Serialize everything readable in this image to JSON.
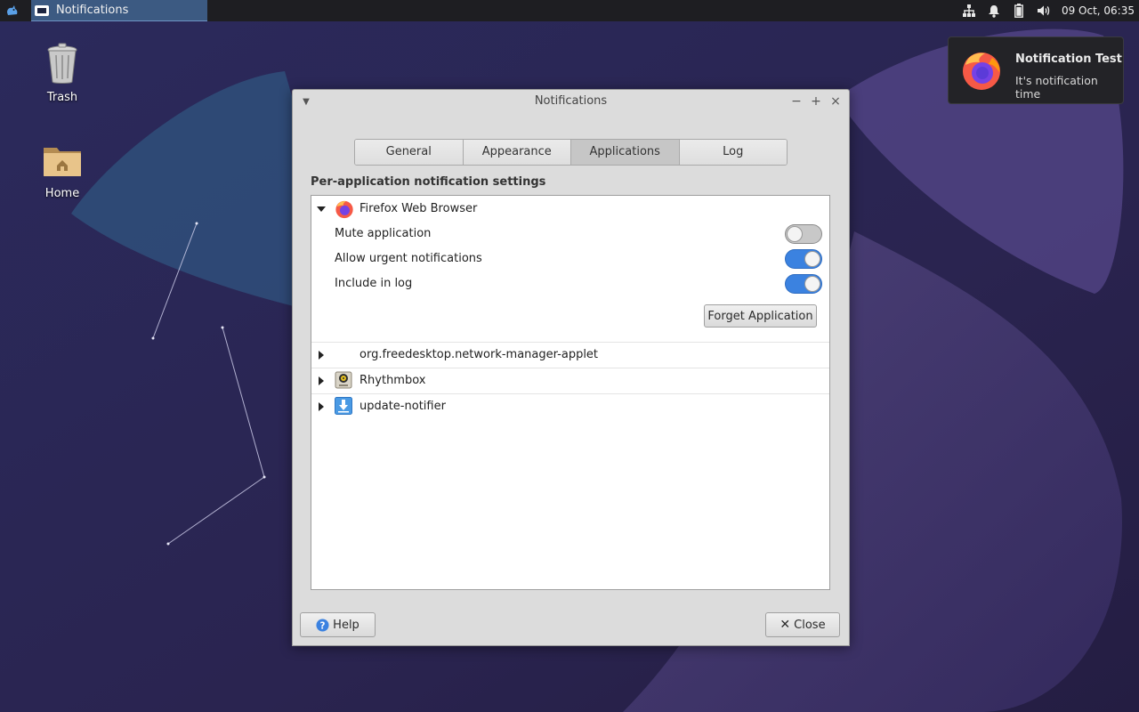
{
  "panel": {
    "task_label": "Notifications",
    "clock": "09 Oct, 06:35",
    "tray_icons": [
      "network-icon",
      "bell-icon",
      "battery-icon",
      "volume-icon"
    ]
  },
  "desktop": {
    "icons": [
      {
        "label": "Trash",
        "icon": "trash-icon"
      },
      {
        "label": "Home",
        "icon": "home-folder-icon"
      }
    ]
  },
  "notification": {
    "title": "Notification Test",
    "body": "It's notification time",
    "icon": "firefox-icon"
  },
  "window": {
    "title": "Notifications",
    "tabs": [
      {
        "label": "General",
        "active": false
      },
      {
        "label": "Appearance",
        "active": false
      },
      {
        "label": "Applications",
        "active": true
      },
      {
        "label": "Log",
        "active": false
      }
    ],
    "section_label": "Per-application notification settings",
    "apps": [
      {
        "name": "Firefox Web Browser",
        "icon": "firefox-icon",
        "expanded": true,
        "options": [
          {
            "label": "Mute application",
            "on": false
          },
          {
            "label": "Allow urgent notifications",
            "on": true
          },
          {
            "label": "Include in log",
            "on": true
          }
        ],
        "forget_label": "Forget Application"
      },
      {
        "name": "org.freedesktop.network-manager-applet",
        "icon": "",
        "expanded": false
      },
      {
        "name": "Rhythmbox",
        "icon": "rhythmbox-icon",
        "expanded": false
      },
      {
        "name": "update-notifier",
        "icon": "download-arrow-icon",
        "expanded": false
      }
    ],
    "help_label": "Help",
    "close_label": "Close"
  },
  "colors": {
    "accent": "#3b82e0",
    "panel_bg": "#1e1e22",
    "desktop_bg": "#2a2550"
  }
}
